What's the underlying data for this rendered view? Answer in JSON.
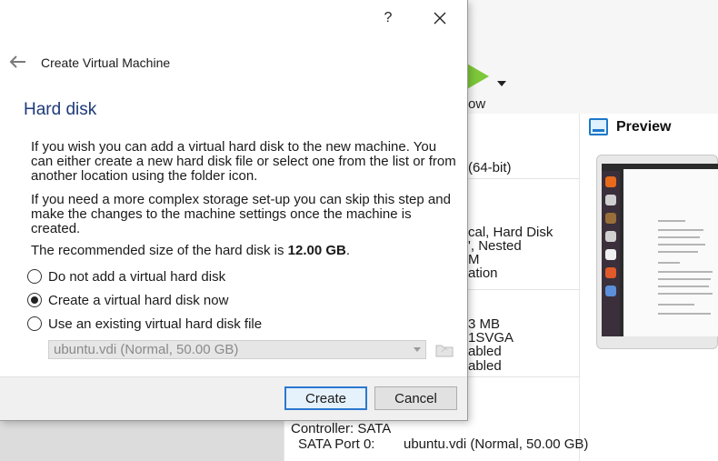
{
  "background": {
    "start_button_label": "ow",
    "details_lines": [
      "(64-bit)",
      "cal, Hard Disk",
      "', Nested",
      "M",
      "ation",
      "3 MB",
      "1SVGA",
      "abled",
      "abled"
    ],
    "preview_title": "Preview",
    "storage_controller": "Controller: SATA",
    "storage_port_label": "SATA Port 0:",
    "storage_port_value": "ubuntu.vdi (Normal, 50.00 GB)"
  },
  "dialog": {
    "help_label": "?",
    "close_label": "✕",
    "wizard_title": "Create Virtual Machine",
    "page_title": "Hard disk",
    "paragraph1": "If you wish you can add a virtual hard disk to the new machine. You can either create a new hard disk file or select one from the list or from another location using the folder icon.",
    "paragraph2": "If you need a more complex storage set-up you can skip this step and make the changes to the machine settings once the machine is created.",
    "recommended_prefix": "The recommended size of the hard disk is ",
    "recommended_size": "12.00 GB",
    "recommended_suffix": ".",
    "options": [
      {
        "label": "Do not add a virtual hard disk",
        "checked": false
      },
      {
        "label": "Create a virtual hard disk now",
        "checked": true
      },
      {
        "label": "Use an existing virtual hard disk file",
        "checked": false
      }
    ],
    "existing_disk_value": "ubuntu.vdi (Normal, 50.00 GB)",
    "create_label": "Create",
    "cancel_label": "Cancel"
  },
  "colors": {
    "accent": "#2b78d0",
    "title_blue": "#1d3a7a",
    "start_green": "#7dc83a"
  }
}
